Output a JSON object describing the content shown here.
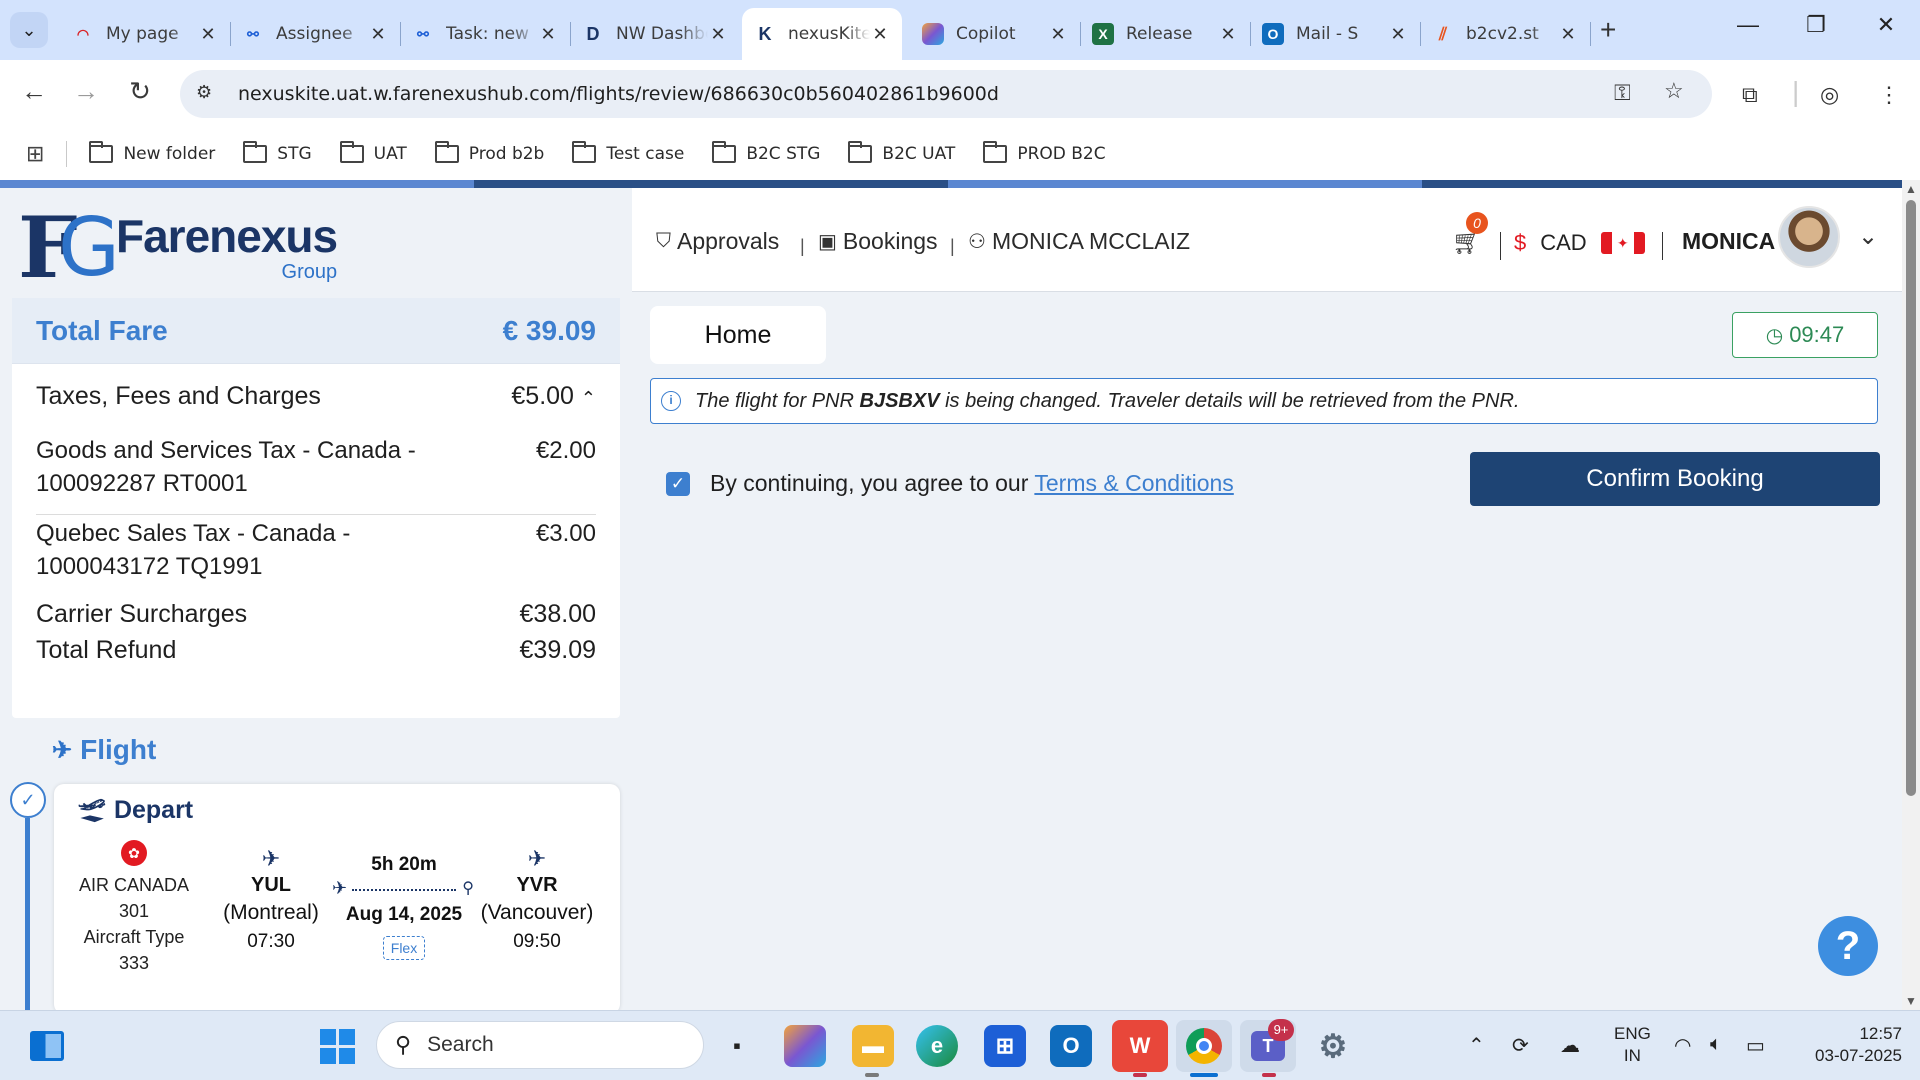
{
  "browser": {
    "tabs": [
      {
        "title": "My page",
        "favicon": "jira-icon",
        "color": "#d9252a"
      },
      {
        "title": "Assignee",
        "favicon": "azure-devops-icon",
        "color": "#1d5fd6"
      },
      {
        "title": "Task: new",
        "favicon": "azure-devops-icon",
        "color": "#1d5fd6"
      },
      {
        "title": "NW Dashboard",
        "favicon": "d-letter-icon",
        "color": "#1b3566"
      },
      {
        "title": "nexusKite",
        "favicon": "k-letter-icon",
        "color": "#1b3566"
      },
      {
        "title": "Copilot",
        "favicon": "copilot-icon",
        "color": "#7a57d1"
      },
      {
        "title": "Release",
        "favicon": "excel-icon",
        "color": "#1f7244"
      },
      {
        "title": "Mail - S",
        "favicon": "outlook-icon",
        "color": "#0f6cbd"
      },
      {
        "title": "b2cv2.st",
        "favicon": "b2c-icon",
        "color": "#e8541e"
      }
    ],
    "tab_initials": {
      "d": "D",
      "k": "K"
    },
    "close_glyph": "✕",
    "new_tab_glyph": "+",
    "url": "nexuskite.uat.w.farenexushub.com/flights/review/686630c0b560402861b9600d",
    "bookmarks": [
      "New folder",
      "STG",
      "UAT",
      "Prod b2b",
      "Test case",
      "B2C STG",
      "B2C UAT",
      "PROD B2C"
    ]
  },
  "page": {
    "progress": {
      "segments": 4,
      "dark_segments": [
        1,
        3
      ]
    },
    "logo": {
      "name": "Farenexus",
      "sub": "Group",
      "mark_f": "F",
      "mark_g": "G"
    },
    "fare": {
      "total_label": "Total Fare",
      "total_amount": "€ 39.09",
      "taxes_label": "Taxes, Fees and Charges",
      "taxes_amount": "€5.00",
      "collapse_glyph": "⌃",
      "items": [
        {
          "label": "Goods and Services Tax - Canada - 100092287 RT0001",
          "amount": "€2.00"
        },
        {
          "label": "Quebec Sales Tax - Canada - 1000043172 TQ1991",
          "amount": "€3.00"
        }
      ],
      "carrier_label": "Carrier Surcharges",
      "carrier_amount": "€38.00",
      "refund_label": "Total Refund",
      "refund_amount": "€39.09"
    },
    "flight": {
      "section_title": "Flight",
      "depart_title": "Depart",
      "airline": "AIR CANADA",
      "flight_number": "301",
      "aircraft_label": "Aircraft Type",
      "aircraft_type": "333",
      "origin": {
        "code": "YUL",
        "city": "(Montreal)",
        "time": "07:30"
      },
      "destination": {
        "code": "YVR",
        "city": "(Vancouver)",
        "time": "09:50"
      },
      "duration": "5h 20m",
      "date": "Aug 14, 2025",
      "fare_type": "Flex"
    },
    "nav": {
      "approvals": "Approvals",
      "bookings": "Bookings",
      "user_full": "MONICA MCCLAIZ",
      "separator": "|",
      "cart_count": "0",
      "currency_symbol": "$",
      "currency": "CAD",
      "user_short": "MONICA"
    },
    "home_tab": "Home",
    "timer": "09:47",
    "info": {
      "prefix": "The flight for PNR ",
      "pnr": "BJSBXV",
      "suffix": " is being changed. Traveler details will be retrieved from the PNR."
    },
    "terms": {
      "checked": true,
      "text": "By continuing, you agree to our",
      "link": "Terms & Conditions"
    },
    "confirm_button": "Confirm Booking",
    "help": "?"
  },
  "taskbar": {
    "search_placeholder": "Search",
    "teams_badge": "9+",
    "lang_top": "ENG",
    "lang_bottom": "IN",
    "time": "12:57",
    "date": "03-07-2025"
  },
  "colors": {
    "brand_dark": "#1b3566",
    "brand_blue": "#3d7fcf",
    "confirm": "#1e4474",
    "timer_green": "#2d8a55"
  }
}
